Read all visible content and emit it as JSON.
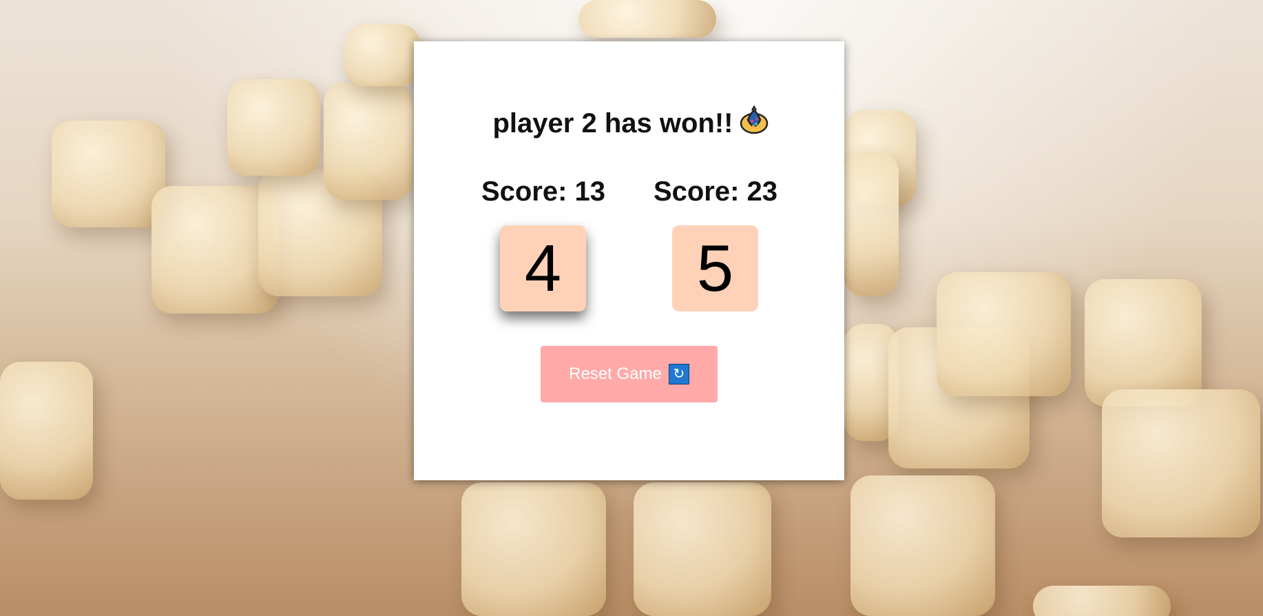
{
  "status": {
    "message": "player 2 has won!!",
    "icon": "trophy-icon"
  },
  "players": [
    {
      "score_text": "Score: 13",
      "die_value": "4",
      "active": true
    },
    {
      "score_text": "Score: 23",
      "die_value": "5",
      "active": false
    }
  ],
  "reset_button": {
    "label": "Reset Game",
    "icon": "repeat-icon"
  },
  "colors": {
    "die_face": "#ffd2b8",
    "reset_button": "#ffa9a9",
    "card": "#ffffff"
  }
}
